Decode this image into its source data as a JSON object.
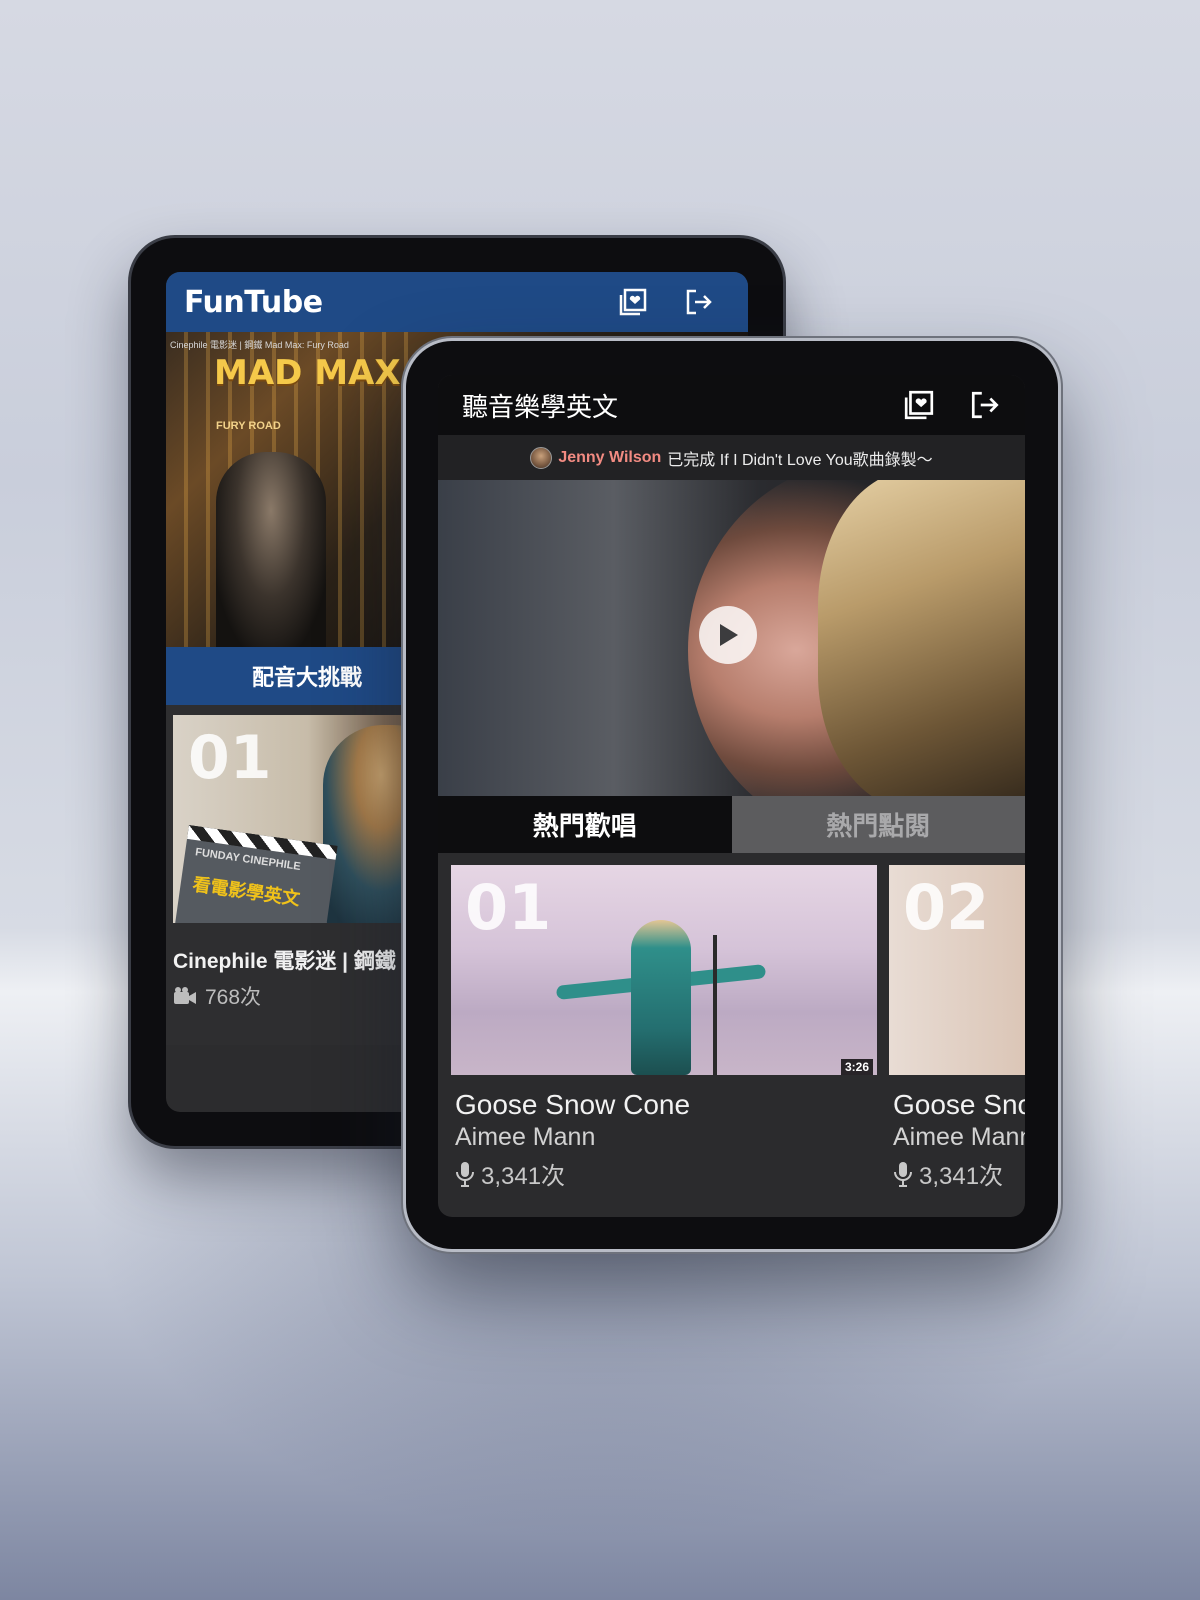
{
  "back_app": {
    "logo": "FunTube",
    "header_icons": [
      "video-library-icon",
      "logout-icon"
    ],
    "video": {
      "caption": "Cinephile 電影迷 | 鋼鐵 Mad Max: Fury Road",
      "poster_title": "MAD MAX",
      "poster_subtitle": "FURY ROAD"
    },
    "tab_label": "配音大挑戰",
    "card": {
      "rank": "01",
      "clapper_top": "FUNDAY   CINEPHILE",
      "clapper_text": "看電影學英文",
      "title": "Cinephile 電影迷 | 鋼鐵",
      "count": "768次",
      "count_icon": "video-camera-icon"
    }
  },
  "front_app": {
    "title": "聽音樂學英文",
    "header_icons": [
      "video-library-icon",
      "logout-icon"
    ],
    "notice": {
      "user": "Jenny Wilson",
      "message": "已完成 If I Didn't Love You歌曲錄製～"
    },
    "player": {
      "play_icon": "play-icon"
    },
    "tabs": [
      {
        "label": "熱門歡唱",
        "active": true
      },
      {
        "label": "熱門點閱",
        "active": false
      }
    ],
    "songs": [
      {
        "rank": "01",
        "title": "Goose Snow Cone",
        "artist": "Aimee Mann",
        "count": "3,341次",
        "duration": "3:26",
        "count_icon": "microphone-icon"
      },
      {
        "rank": "02",
        "title": "Goose Snow Cone",
        "artist": "Aimee Mann",
        "count": "3,341次",
        "duration": "",
        "count_icon": "microphone-icon"
      }
    ]
  },
  "colors": {
    "funtube_blue": "#1f4a86",
    "notice_user": "#f28b82",
    "front_header": "#0d0d0f",
    "inactive_tab": "#5c5c5e"
  }
}
